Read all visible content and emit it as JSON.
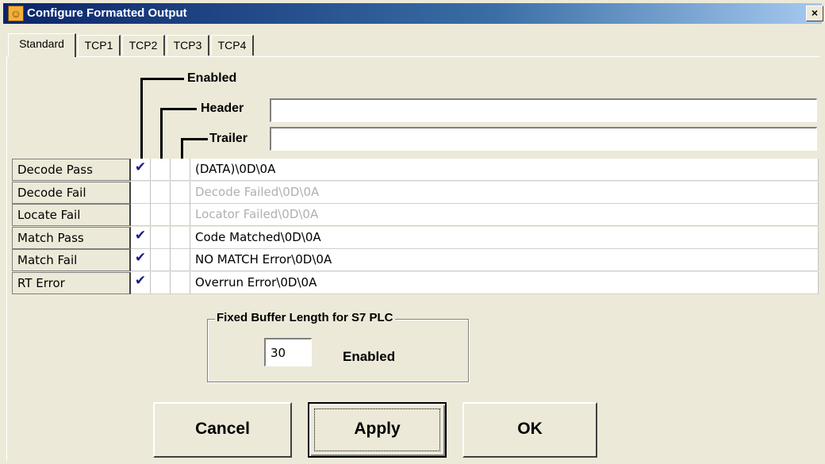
{
  "window": {
    "title": "Configure Formatted Output",
    "close_glyph": "×"
  },
  "tabs": [
    "Standard",
    "TCP1",
    "TCP2",
    "TCP3",
    "TCP4"
  ],
  "headers": {
    "enabled_label": "Enabled",
    "header_label": "Header",
    "header_value": "",
    "trailer_label": "Trailer",
    "trailer_value": ""
  },
  "rows": [
    {
      "label": "Decode Pass",
      "enabled": "✔",
      "header": "",
      "trailer": "",
      "text": "(DATA)\\0D\\0A",
      "dim": false
    },
    {
      "label": "Decode Fail",
      "enabled": "",
      "header": "",
      "trailer": "",
      "text": "Decode Failed\\0D\\0A",
      "dim": true
    },
    {
      "label": "Locate Fail",
      "enabled": "",
      "header": "",
      "trailer": "",
      "text": "Locator Failed\\0D\\0A",
      "dim": true
    },
    {
      "label": "Match Pass",
      "enabled": "✔",
      "header": "",
      "trailer": "",
      "text": "Code Matched\\0D\\0A",
      "dim": false
    },
    {
      "label": "Match Fail",
      "enabled": "✔",
      "header": "",
      "trailer": "",
      "text": "NO MATCH Error\\0D\\0A",
      "dim": false
    },
    {
      "label": "RT Error",
      "enabled": "✔",
      "header": "",
      "trailer": "",
      "text": "Overrun Error\\0D\\0A",
      "dim": false
    }
  ],
  "fixed_buffer": {
    "title": "Fixed Buffer Length for S7 PLC",
    "value": "30",
    "status": "Enabled"
  },
  "buttons": {
    "cancel": "Cancel",
    "apply": "Apply",
    "ok": "OK"
  },
  "icons": {
    "app": "running-man-icon",
    "close": "close-icon",
    "check": "checkmark-icon"
  },
  "colors": {
    "titlebar_start": "#0a246a",
    "titlebar_end": "#a6caf0",
    "check": "#1c1c8c",
    "dim_text": "#b0b0b0"
  }
}
